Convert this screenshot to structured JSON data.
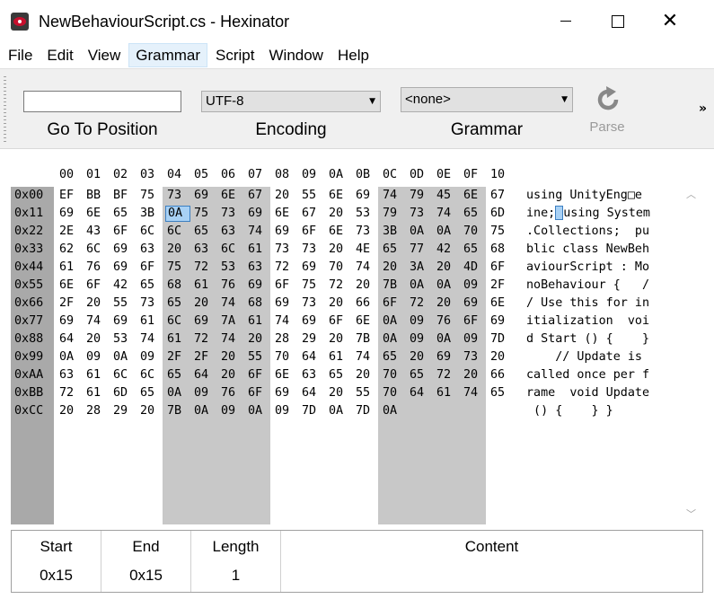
{
  "window": {
    "title": "NewBehaviourScript.cs - Hexinator"
  },
  "menu": [
    "File",
    "Edit",
    "View",
    "Grammar",
    "Script",
    "Window",
    "Help"
  ],
  "toolbar": {
    "goto_value": "",
    "goto_label": "Go To Position",
    "encoding_value": "UTF-8",
    "encoding_label": "Encoding",
    "grammar_value": "<none>",
    "grammar_label": "Grammar",
    "parse_label": "Parse",
    "parse_icon": "refresh-icon",
    "overflow": "»"
  },
  "hex": {
    "columns": [
      "00",
      "01",
      "02",
      "03",
      "04",
      "05",
      "06",
      "07",
      "08",
      "09",
      "0A",
      "0B",
      "0C",
      "0D",
      "0E",
      "0F",
      "10"
    ],
    "rows": [
      {
        "addr": "0x00",
        "bytes": [
          "EF",
          "BB",
          "BF",
          "75",
          "73",
          "69",
          "6E",
          "67",
          "20",
          "55",
          "6E",
          "69",
          "74",
          "79",
          "45",
          "6E",
          "67"
        ],
        "ascii": "using UnityEng□e"
      },
      {
        "addr": "0x11",
        "bytes": [
          "69",
          "6E",
          "65",
          "3B",
          "0A",
          "75",
          "73",
          "69",
          "6E",
          "67",
          "20",
          "53",
          "79",
          "73",
          "74",
          "65",
          "6D"
        ],
        "ascii_pre": "ine;",
        "ascii_post": "using System"
      },
      {
        "addr": "0x22",
        "bytes": [
          "2E",
          "43",
          "6F",
          "6C",
          "6C",
          "65",
          "63",
          "74",
          "69",
          "6F",
          "6E",
          "73",
          "3B",
          "0A",
          "0A",
          "70",
          "75"
        ],
        "ascii": ".Collections;  pu"
      },
      {
        "addr": "0x33",
        "bytes": [
          "62",
          "6C",
          "69",
          "63",
          "20",
          "63",
          "6C",
          "61",
          "73",
          "73",
          "20",
          "4E",
          "65",
          "77",
          "42",
          "65",
          "68"
        ],
        "ascii": "blic class NewBeh"
      },
      {
        "addr": "0x44",
        "bytes": [
          "61",
          "76",
          "69",
          "6F",
          "75",
          "72",
          "53",
          "63",
          "72",
          "69",
          "70",
          "74",
          "20",
          "3A",
          "20",
          "4D",
          "6F"
        ],
        "ascii": "aviourScript : Mo"
      },
      {
        "addr": "0x55",
        "bytes": [
          "6E",
          "6F",
          "42",
          "65",
          "68",
          "61",
          "76",
          "69",
          "6F",
          "75",
          "72",
          "20",
          "7B",
          "0A",
          "0A",
          "09",
          "2F"
        ],
        "ascii": "noBehaviour {   /"
      },
      {
        "addr": "0x66",
        "bytes": [
          "2F",
          "20",
          "55",
          "73",
          "65",
          "20",
          "74",
          "68",
          "69",
          "73",
          "20",
          "66",
          "6F",
          "72",
          "20",
          "69",
          "6E"
        ],
        "ascii": "/ Use this for in"
      },
      {
        "addr": "0x77",
        "bytes": [
          "69",
          "74",
          "69",
          "61",
          "6C",
          "69",
          "7A",
          "61",
          "74",
          "69",
          "6F",
          "6E",
          "0A",
          "09",
          "76",
          "6F",
          "69"
        ],
        "ascii": "itialization  voi"
      },
      {
        "addr": "0x88",
        "bytes": [
          "64",
          "20",
          "53",
          "74",
          "61",
          "72",
          "74",
          "20",
          "28",
          "29",
          "20",
          "7B",
          "0A",
          "09",
          "0A",
          "09",
          "7D"
        ],
        "ascii": "d Start () {    }"
      },
      {
        "addr": "0x99",
        "bytes": [
          "0A",
          "09",
          "0A",
          "09",
          "2F",
          "2F",
          "20",
          "55",
          "70",
          "64",
          "61",
          "74",
          "65",
          "20",
          "69",
          "73",
          "20"
        ],
        "ascii": "    // Update is "
      },
      {
        "addr": "0xAA",
        "bytes": [
          "63",
          "61",
          "6C",
          "6C",
          "65",
          "64",
          "20",
          "6F",
          "6E",
          "63",
          "65",
          "20",
          "70",
          "65",
          "72",
          "20",
          "66"
        ],
        "ascii": "called once per f"
      },
      {
        "addr": "0xBB",
        "bytes": [
          "72",
          "61",
          "6D",
          "65",
          "0A",
          "09",
          "76",
          "6F",
          "69",
          "64",
          "20",
          "55",
          "70",
          "64",
          "61",
          "74",
          "65"
        ],
        "ascii": "rame  void Update"
      },
      {
        "addr": "0xCC",
        "bytes": [
          "20",
          "28",
          "29",
          "20",
          "7B",
          "0A",
          "09",
          "0A",
          "09",
          "7D",
          "0A",
          "7D",
          "0A"
        ],
        "ascii": " () {    } }"
      }
    ]
  },
  "selection": {
    "start_label": "Start",
    "start_value": "0x15",
    "end_label": "End",
    "end_value": "0x15",
    "length_label": "Length",
    "length_value": "1",
    "content_label": "Content",
    "content_value": ""
  }
}
